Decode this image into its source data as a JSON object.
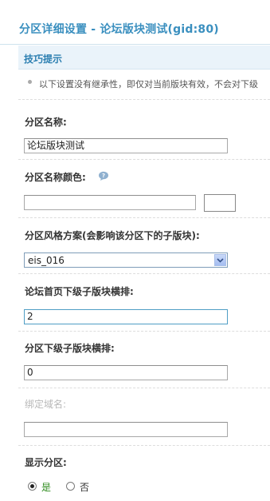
{
  "page_title": "分区详细设置 - 论坛版块测试(gid:80)",
  "tips": {
    "heading": "技巧提示",
    "text": "以下设置没有继承性，即仅对当前版块有效，不会对下级"
  },
  "fields": {
    "name": {
      "label": "分区名称:",
      "value": "论坛版块测试"
    },
    "color": {
      "label": "分区名称颜色:",
      "value": "",
      "swatch": "#ffffff"
    },
    "style": {
      "label": "分区风格方案(会影响该分区下的子版块):",
      "selected": "eis_016"
    },
    "forum_columns": {
      "label": "论坛首页下级子版块横排:",
      "value": "2"
    },
    "sub_columns": {
      "label": "分区下级子版块横排:",
      "value": "0"
    },
    "domain": {
      "label": "绑定域名:",
      "value": ""
    },
    "display": {
      "label": "显示分区:",
      "options": [
        "是",
        "否"
      ],
      "selected": "是"
    }
  },
  "colors": {
    "accent": "#3a8fbf",
    "yes_green": "#2e8b1e"
  },
  "icons": {
    "help": "help-bubble-icon",
    "bullet": "bullet-icon",
    "dropdown": "chevron-down-icon"
  }
}
